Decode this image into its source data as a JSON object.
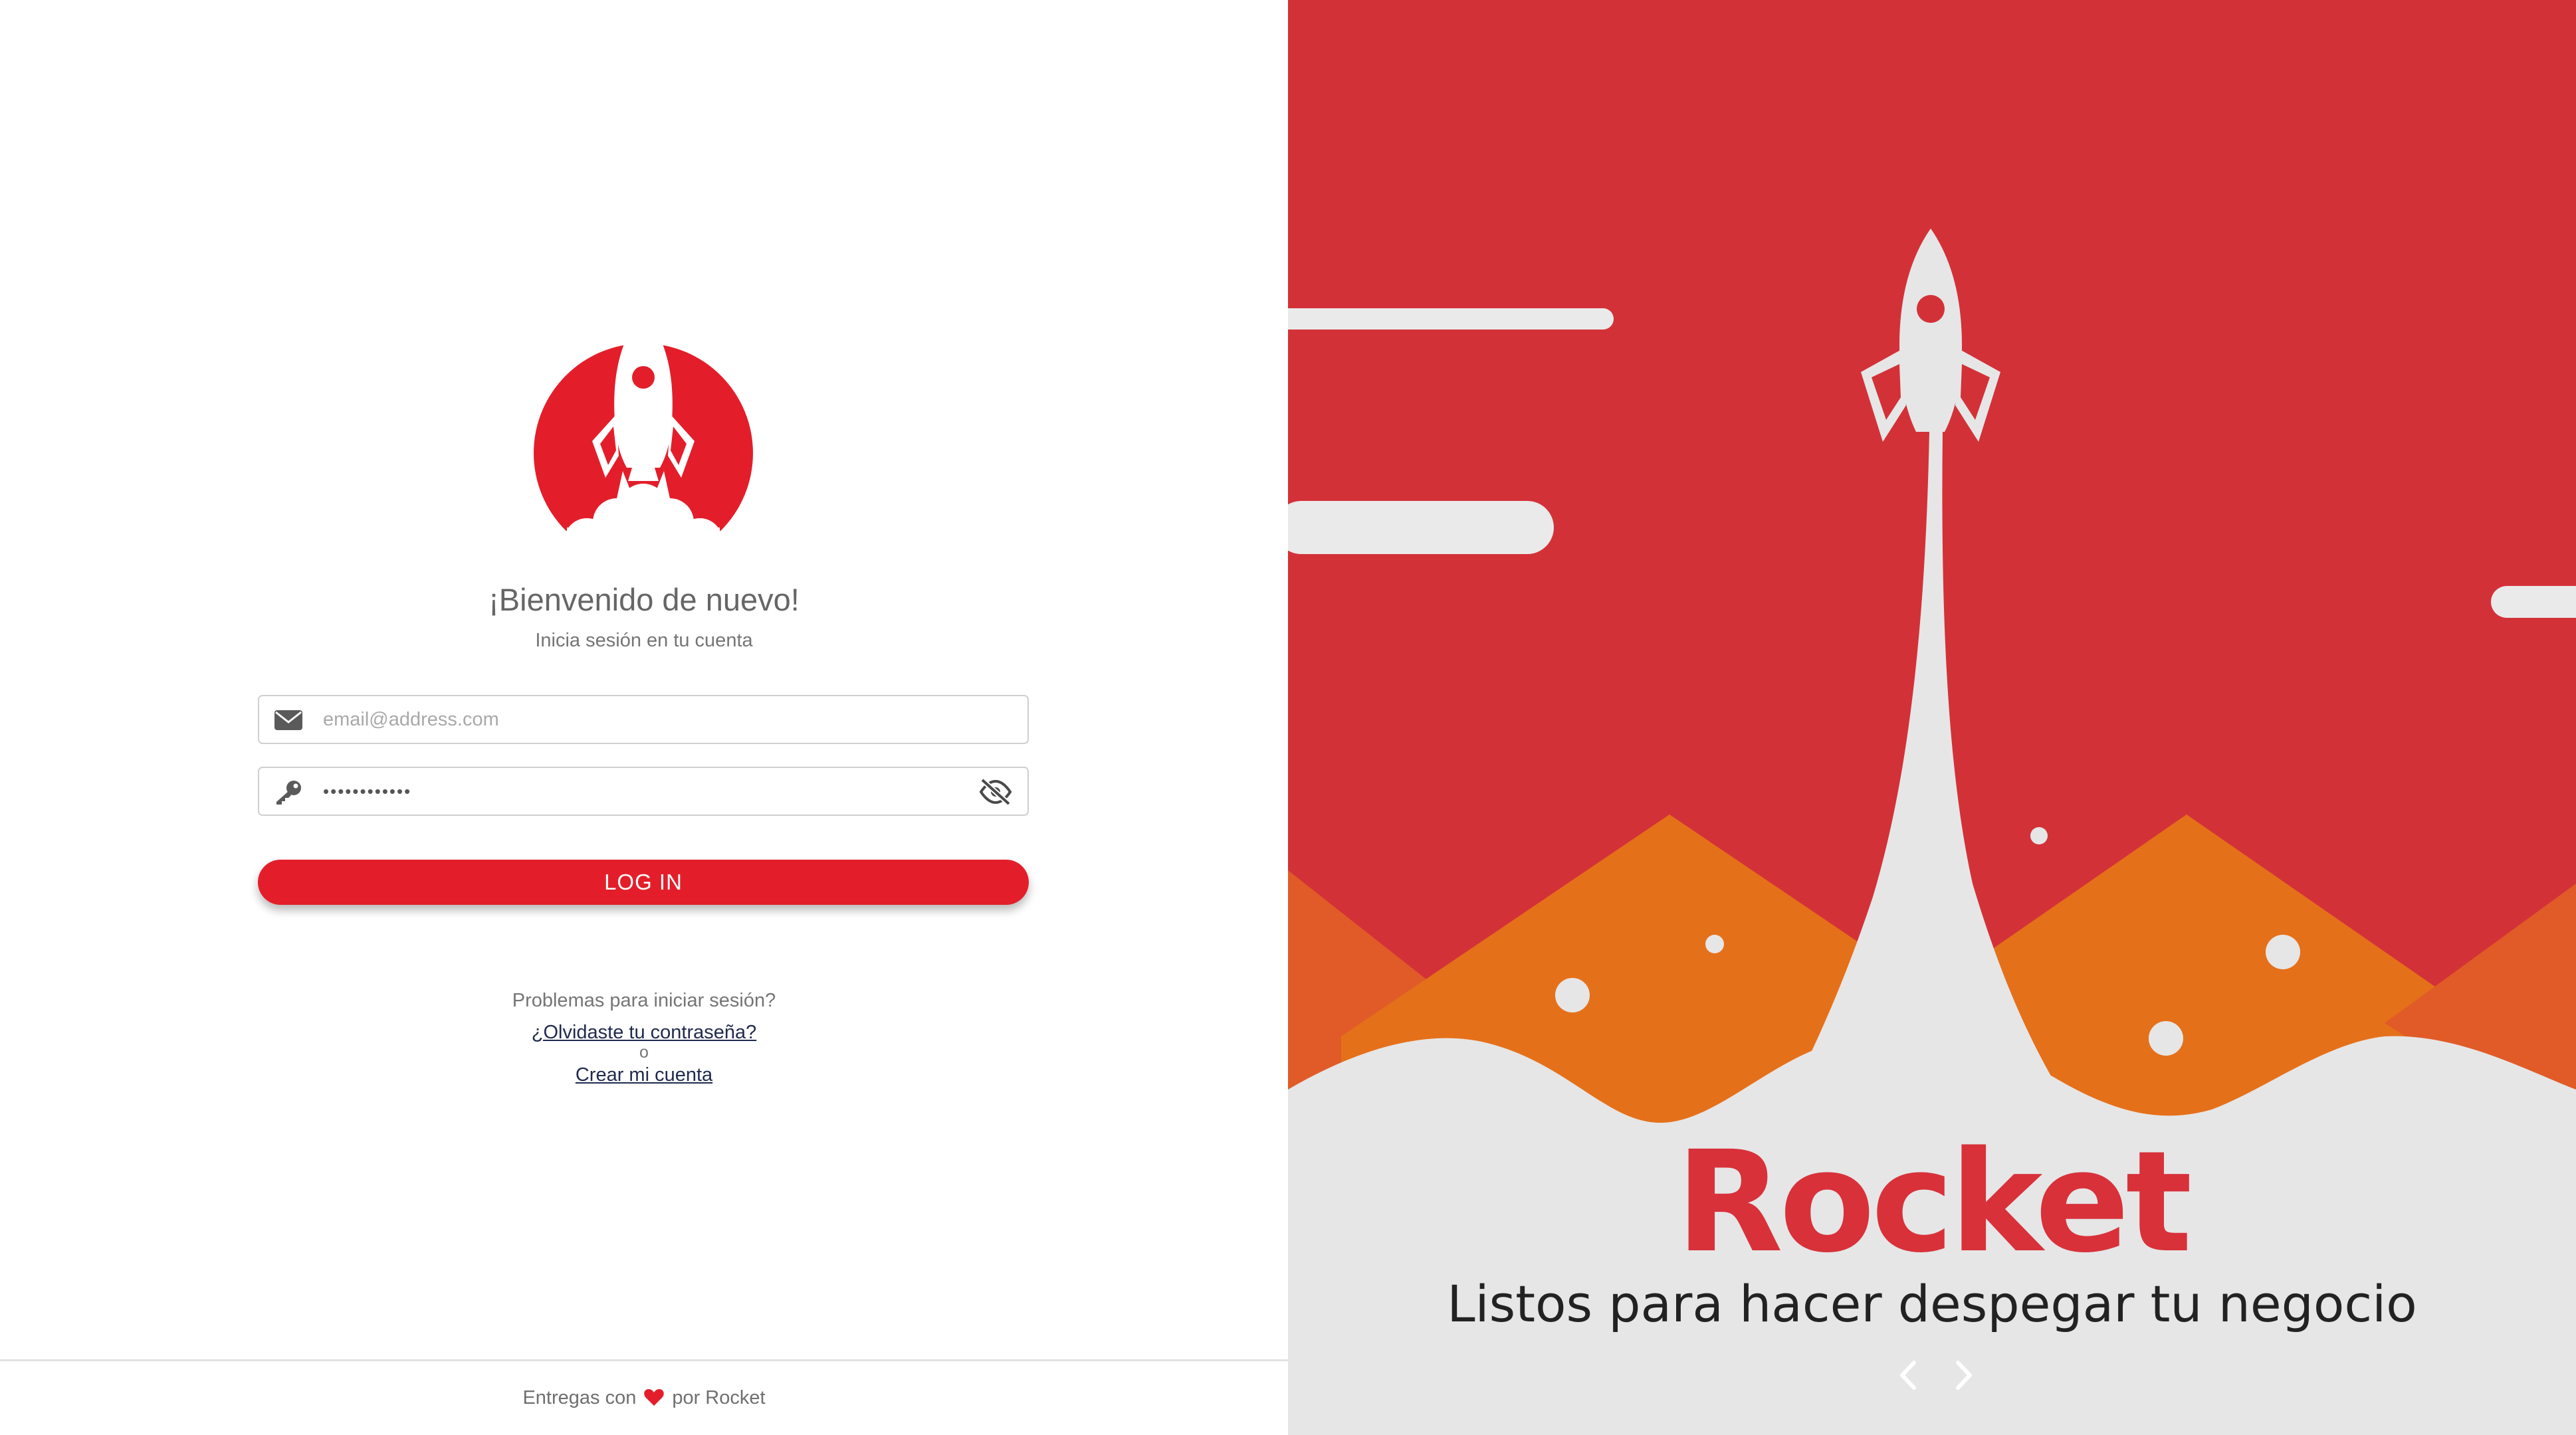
{
  "login": {
    "welcome_title": "¡Bienvenido de nuevo!",
    "subtitle": "Inicia sesión en tu cuenta",
    "email_placeholder": "email@address.com",
    "password_value": "••••••••••••",
    "login_button": "LOG IN",
    "trouble_text": "Problemas para iniciar sesión?",
    "forgot_link": "¿Olvidaste tu contraseña?",
    "or_text": "o",
    "create_link": "Crear mi cuenta"
  },
  "footer": {
    "prefix": "Entregas con",
    "suffix": "por Rocket"
  },
  "hero": {
    "brand": "Rocket",
    "tagline": "Listos para hacer despegar tu negocio",
    "icons": [
      "chevron-left-icon",
      "chevron-right-icon"
    ]
  },
  "icons": {
    "logo": "rocket-logo-icon",
    "email": "envelope-icon",
    "password": "key-icon",
    "visibility": "eye-slash-icon",
    "heart": "heart-icon"
  },
  "colors": {
    "primary_red": "#e31e2a",
    "hero_red": "#d33138",
    "hero_orange": "#e5701a",
    "hero_light": "#e6e6e6",
    "link": "#1f2a4d",
    "text_gray": "#757575"
  }
}
